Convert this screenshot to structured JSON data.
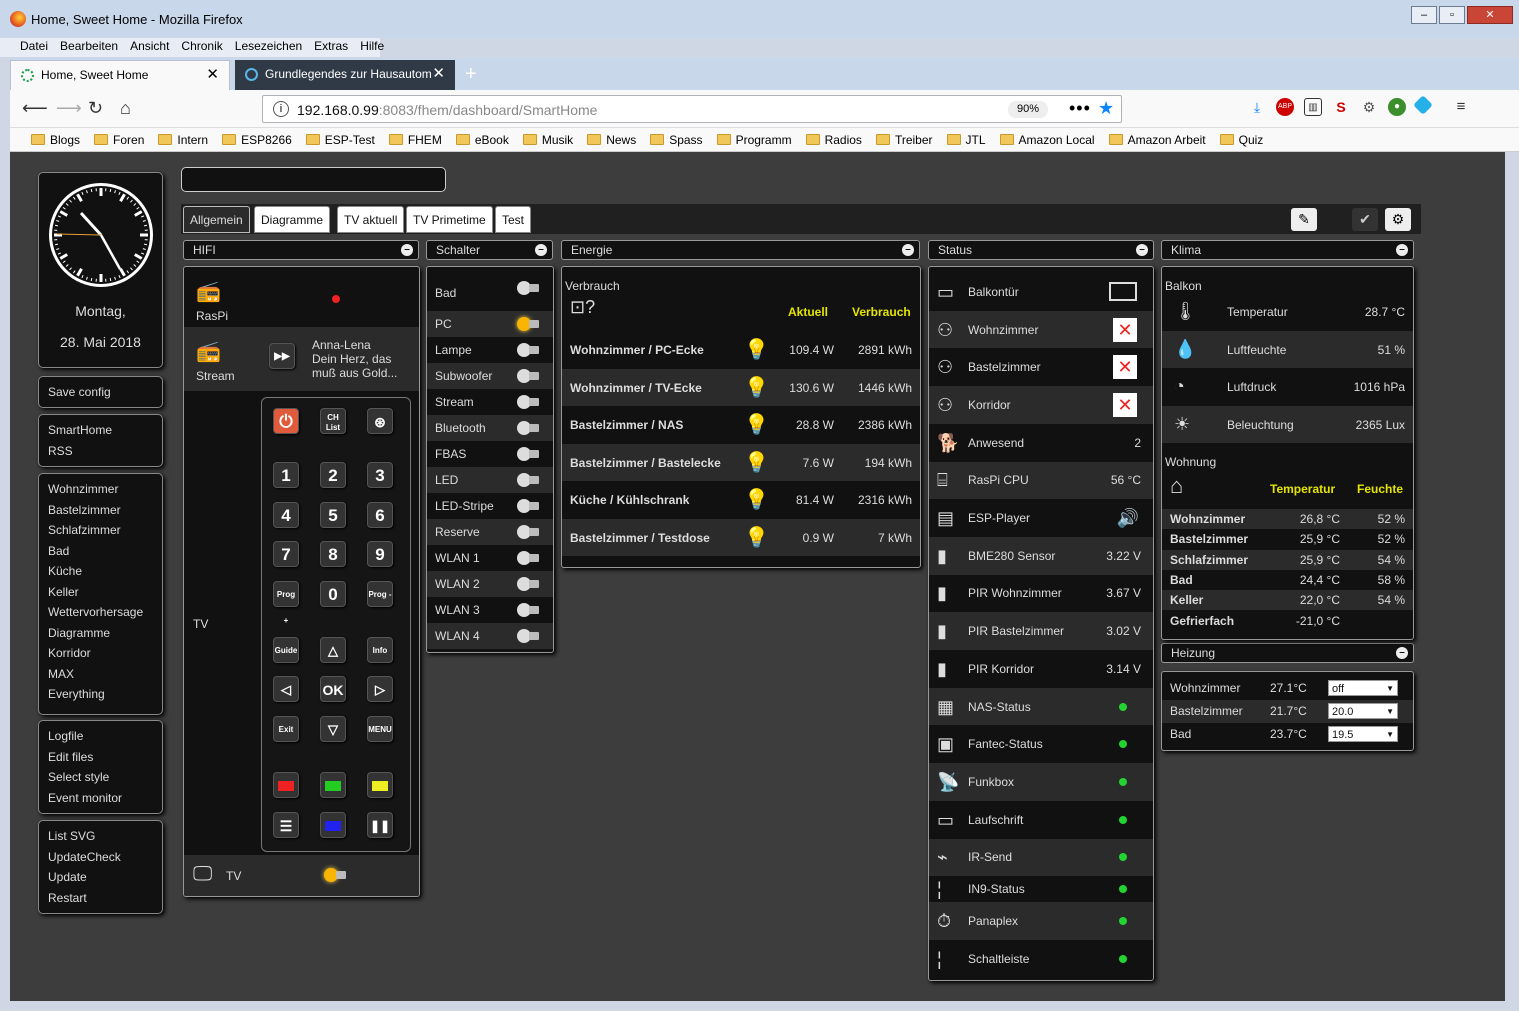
{
  "window": {
    "title": "Home, Sweet Home - Mozilla Firefox"
  },
  "menu": [
    "Datei",
    "Bearbeiten",
    "Ansicht",
    "Chronik",
    "Lesezeichen",
    "Extras",
    "Hilfe"
  ],
  "tabs": [
    {
      "label": "Home, Sweet Home"
    },
    {
      "label": "Grundlegendes zur Hausautom"
    }
  ],
  "url": {
    "host": "192.168.0.99",
    "rest": ":8083/fhem/dashboard/SmartHome"
  },
  "zoom": "90%",
  "bookmarks": [
    "Blogs",
    "Foren",
    "Intern",
    "ESP8266",
    "ESP-Test",
    "FHEM",
    "eBook",
    "Musik",
    "News",
    "Spass",
    "Programm",
    "Radios",
    "Treiber",
    "JTL",
    "Amazon Local",
    "Amazon Arbeit",
    "Quiz"
  ],
  "clock": {
    "day": "Montag,",
    "date": "28. Mai 2018"
  },
  "side1": [
    "Save config"
  ],
  "side2": [
    "SmartHome",
    "RSS"
  ],
  "side3": [
    "Wohnzimmer",
    "Bastelzimmer",
    "Schlafzimmer",
    "Bad",
    "Küche",
    "Keller",
    "Wettervorhersage",
    "Diagramme",
    "Korridor",
    "MAX",
    "Everything"
  ],
  "side4": [
    "Logfile",
    "Edit files",
    "Select style",
    "Event monitor"
  ],
  "side5": [
    "List SVG",
    "UpdateCheck",
    "Update",
    "Restart"
  ],
  "dashtabs": [
    "Allgemein",
    "Diagramme",
    "TV aktuell",
    "TV Primetime",
    "Test"
  ],
  "hifi": {
    "title": "HIFI",
    "raspi": "RasPi",
    "stream": "Stream",
    "song1": "Anna-Lena",
    "song2": "Dein Herz, das",
    "song3": "muß aus Gold...",
    "tvlabel": "TV",
    "tvbottom": "TV",
    "keys": [
      [
        "1",
        "2",
        "3"
      ],
      [
        "4",
        "5",
        "6"
      ],
      [
        "7",
        "8",
        "9"
      ]
    ],
    "zero": "0",
    "progup": "Prog +",
    "progdn": "Prog -",
    "guide": "Guide",
    "info": "Info",
    "ok": "OK",
    "exit": "Exit",
    "menu": "MENU",
    "chlist": "CH List"
  },
  "schalter": {
    "title": "Schalter",
    "items": [
      {
        "n": "Bad"
      },
      {
        "n": "PC"
      },
      {
        "n": "Lampe"
      },
      {
        "n": "Subwoofer"
      },
      {
        "n": "Stream"
      },
      {
        "n": "Bluetooth"
      },
      {
        "n": "FBAS"
      },
      {
        "n": "LED"
      },
      {
        "n": "LED-Stripe"
      },
      {
        "n": "Reserve"
      },
      {
        "n": "WLAN 1"
      },
      {
        "n": "WLAN 2"
      },
      {
        "n": "WLAN 3"
      },
      {
        "n": "WLAN 4"
      }
    ]
  },
  "energie": {
    "title": "Energie",
    "sub": "Verbrauch",
    "h1": "Aktuell",
    "h2": "Verbrauch",
    "rows": [
      {
        "n": "Wohnzimmer / PC-Ecke",
        "a": "109.4 W",
        "v": "2891 kWh"
      },
      {
        "n": "Wohnzimmer / TV-Ecke",
        "a": "130.6 W",
        "v": "1446 kWh"
      },
      {
        "n": "Bastelzimmer / NAS",
        "a": "28.8 W",
        "v": "2386 kWh"
      },
      {
        "n": "Bastelzimmer / Bastelecke",
        "a": "7.6 W",
        "v": "194 kWh"
      },
      {
        "n": "Küche / Kühlschrank",
        "a": "81.4 W",
        "v": "2316 kWh"
      },
      {
        "n": "Bastelzimmer / Testdose",
        "a": "0.9 W",
        "v": "7 kWh"
      }
    ]
  },
  "status": {
    "title": "Status",
    "rows": [
      {
        "n": "Balkontür",
        "v": ""
      },
      {
        "n": "Wohnzimmer",
        "v": ""
      },
      {
        "n": "Bastelzimmer",
        "v": ""
      },
      {
        "n": "Korridor",
        "v": ""
      },
      {
        "n": "Anwesend",
        "v": "2"
      },
      {
        "n": "RasPi CPU",
        "v": "56 °C"
      },
      {
        "n": "ESP-Player",
        "v": ""
      },
      {
        "n": "BME280 Sensor",
        "v": "3.22 V"
      },
      {
        "n": "PIR Wohnzimmer",
        "v": "3.67 V"
      },
      {
        "n": "PIR Bastelzimmer",
        "v": "3.02 V"
      },
      {
        "n": "PIR Korridor",
        "v": "3.14 V"
      },
      {
        "n": "NAS-Status",
        "v": ""
      },
      {
        "n": "Fantec-Status",
        "v": ""
      },
      {
        "n": "Funkbox",
        "v": ""
      },
      {
        "n": "Laufschrift",
        "v": ""
      },
      {
        "n": "IR-Send",
        "v": ""
      },
      {
        "n": "IN9-Status",
        "v": ""
      },
      {
        "n": "Panaplex",
        "v": ""
      },
      {
        "n": "Schaltleiste",
        "v": ""
      }
    ]
  },
  "klima": {
    "title": "Klima",
    "balkon": "Balkon",
    "brows": [
      {
        "n": "Temperatur",
        "v": "28.7 °C"
      },
      {
        "n": "Luftfeuchte",
        "v": "51 %"
      },
      {
        "n": "Luftdruck",
        "v": "1016 hPa"
      },
      {
        "n": "Beleuchtung",
        "v": "2365 Lux"
      }
    ],
    "wohnung": "Wohnung",
    "h1": "Temperatur",
    "h2": "Feuchte",
    "wrows": [
      {
        "n": "Wohnzimmer",
        "t": "26,8 °C",
        "f": "52 %"
      },
      {
        "n": "Bastelzimmer",
        "t": "25,9 °C",
        "f": "52 %"
      },
      {
        "n": "Schlafzimmer",
        "t": "25,9 °C",
        "f": "54 %"
      },
      {
        "n": "Bad",
        "t": "24,4 °C",
        "f": "58 %"
      },
      {
        "n": "Keller",
        "t": "22,0 °C",
        "f": "54 %"
      },
      {
        "n": "Gefrierfach",
        "t": "-21,0 °C",
        "f": ""
      }
    ]
  },
  "heizung": {
    "title": "Heizung",
    "rows": [
      {
        "n": "Wohnzimmer",
        "t": "27.1°C",
        "s": "off"
      },
      {
        "n": "Bastelzimmer",
        "t": "21.7°C",
        "s": "20.0"
      },
      {
        "n": "Bad",
        "t": "23.7°C",
        "s": "19.5"
      }
    ]
  }
}
